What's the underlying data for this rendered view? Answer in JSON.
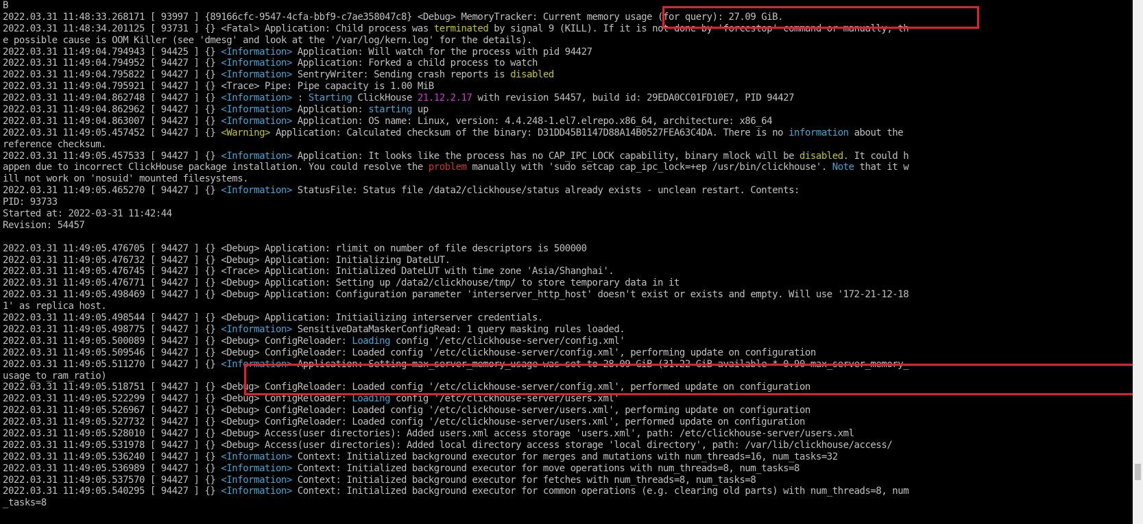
{
  "top_char": "B",
  "lines": [
    [
      {
        "t": "2022.03.31 11:48:33.268171 [ 93997 ] {89166cfc-9547-4cfa-bbf9-c7ae358047c8} <Debug> MemoryTracker: Current memory usage (for query): 27.09 GiB."
      }
    ],
    [
      {
        "t": "2022.03.31 11:48:34.201125 [ 93731 ] {} <Fatal> Application: Child process was "
      },
      {
        "t": "terminated",
        "c": "hl-y"
      },
      {
        "t": " by signal 9 (KILL). If it is not done by 'forcestop' command or manually, th"
      }
    ],
    [
      {
        "t": "e possible cause is OOM Killer (see 'dmesg' and look at the '/var/log/kern.log' for the details)."
      }
    ],
    [
      {
        "t": "2022.03.31 11:49:04.794943 [ 94425 ] {} "
      },
      {
        "t": "<Information>",
        "c": "lvl-info"
      },
      {
        "t": " Application: Will watch for the process with pid 94427"
      }
    ],
    [
      {
        "t": "2022.03.31 11:49:04.794952 [ 94427 ] {} "
      },
      {
        "t": "<Information>",
        "c": "lvl-info"
      },
      {
        "t": " Application: Forked a child process to watch"
      }
    ],
    [
      {
        "t": "2022.03.31 11:49:04.795822 [ 94427 ] {} "
      },
      {
        "t": "<Information>",
        "c": "lvl-info"
      },
      {
        "t": " SentryWriter: Sending crash reports is "
      },
      {
        "t": "disabled",
        "c": "hl-y"
      }
    ],
    [
      {
        "t": "2022.03.31 11:49:04.795921 [ 94427 ] {} <Trace> Pipe: Pipe capacity is 1.00 MiB"
      }
    ],
    [
      {
        "t": "2022.03.31 11:49:04.862748 [ 94427 ] {} "
      },
      {
        "t": "<Information>",
        "c": "lvl-info"
      },
      {
        "t": " : "
      },
      {
        "t": "Starting",
        "c": "hl-b"
      },
      {
        "t": " ClickHouse "
      },
      {
        "t": "21.12.2.17",
        "c": "hl-m"
      },
      {
        "t": " with revision 54457, build id: 29EDA0CC01FD10E7, PID 94427"
      }
    ],
    [
      {
        "t": "2022.03.31 11:49:04.862962 [ 94427 ] {} "
      },
      {
        "t": "<Information>",
        "c": "lvl-info"
      },
      {
        "t": " Application: "
      },
      {
        "t": "starting",
        "c": "hl-b"
      },
      {
        "t": " up"
      }
    ],
    [
      {
        "t": "2022.03.31 11:49:04.863007 [ 94427 ] {} "
      },
      {
        "t": "<Information>",
        "c": "lvl-info"
      },
      {
        "t": " Application: OS name: Linux, version: 4.4.248-1.el7.elrepo.x86_64, architecture: x86_64"
      }
    ],
    [
      {
        "t": "2022.03.31 11:49:05.457452 [ 94427 ] {} "
      },
      {
        "t": "<Warning>",
        "c": "lvl-warn"
      },
      {
        "t": " Application: Calculated checksum of the binary: D31DD45B1147D88A14B0527FEA63C4DA. There is no "
      },
      {
        "t": "information",
        "c": "hl-b"
      },
      {
        "t": " about the"
      }
    ],
    [
      {
        "t": "reference checksum."
      }
    ],
    [
      {
        "t": "2022.03.31 11:49:05.457533 [ 94427 ] {} "
      },
      {
        "t": "<Information>",
        "c": "lvl-info"
      },
      {
        "t": " Application: It looks like the process has no CAP_IPC_LOCK capability, binary mlock will be "
      },
      {
        "t": "disabled",
        "c": "hl-y"
      },
      {
        "t": ". It could h"
      }
    ],
    [
      {
        "t": "appen due to incorrect ClickHouse package installation. You could resolve the "
      },
      {
        "t": "problem",
        "c": "hl-r"
      },
      {
        "t": " manually with 'sudo setcap cap_ipc_lock=+ep /usr/bin/clickhouse'. "
      },
      {
        "t": "Note",
        "c": "hl-b"
      },
      {
        "t": " that it w"
      }
    ],
    [
      {
        "t": "ill not work on 'nosuid' mounted filesystems."
      }
    ],
    [
      {
        "t": "2022.03.31 11:49:05.465270 [ 94427 ] {} "
      },
      {
        "t": "<Information>",
        "c": "lvl-info"
      },
      {
        "t": " StatusFile: Status file /data2/clickhouse/status already exists - unclean restart. Contents:"
      }
    ],
    [
      {
        "t": "PID: 93733"
      }
    ],
    [
      {
        "t": "Started at: 2022-03-31 11:42:44"
      }
    ],
    [
      {
        "t": "Revision: 54457"
      }
    ],
    [
      {
        "t": ""
      }
    ],
    [
      {
        "t": "2022.03.31 11:49:05.476705 [ 94427 ] {} <Debug> Application: rlimit on number of file descriptors is 500000"
      }
    ],
    [
      {
        "t": "2022.03.31 11:49:05.476732 [ 94427 ] {} <Debug> Application: Initializing DateLUT."
      }
    ],
    [
      {
        "t": "2022.03.31 11:49:05.476745 [ 94427 ] {} <Trace> Application: Initialized DateLUT with time zone 'Asia/Shanghai'."
      }
    ],
    [
      {
        "t": "2022.03.31 11:49:05.476771 [ 94427 ] {} <Debug> Application: Setting up /data2/clickhouse/tmp/ to store temporary data in it"
      }
    ],
    [
      {
        "t": "2022.03.31 11:49:05.498469 [ 94427 ] {} <Debug> Application: Configuration parameter 'interserver_http_host' doesn't exist or exists and empty. Will use '172-21-12-18"
      }
    ],
    [
      {
        "t": "1' as replica host."
      }
    ],
    [
      {
        "t": "2022.03.31 11:49:05.498544 [ 94427 ] {} <Debug> Application: Initiailizing interserver credentials."
      }
    ],
    [
      {
        "t": "2022.03.31 11:49:05.498775 [ 94427 ] {} "
      },
      {
        "t": "<Information>",
        "c": "lvl-info"
      },
      {
        "t": " SensitiveDataMaskerConfigRead: 1 query masking rules loaded."
      }
    ],
    [
      {
        "t": "2022.03.31 11:49:05.500089 [ 94427 ] {} <Debug> ConfigReloader: "
      },
      {
        "t": "Loading",
        "c": "hl-b"
      },
      {
        "t": " config '/etc/clickhouse-server/config.xml'"
      }
    ],
    [
      {
        "t": "2022.03.31 11:49:05.509546 [ 94427 ] {} <Debug> ConfigReloader: Loaded config '/etc/clickhouse-server/config.xml', performing update on configuration"
      }
    ],
    [
      {
        "t": "2022.03.31 11:49:05.511270 [ 94427 ] {} "
      },
      {
        "t": "<Information>",
        "c": "lvl-info"
      },
      {
        "t": " Application: Setting max_server_memory_usage was set to 28.09 GiB (31.22 GiB available * 0.90 max_server_memory_"
      }
    ],
    [
      {
        "t": "usage_to_ram_ratio)"
      }
    ],
    [
      {
        "t": "2022.03.31 11:49:05.518751 [ 94427 ] {} <Debug> ConfigReloader: Loaded config '/etc/clickhouse-server/config.xml', performed update on configuration"
      }
    ],
    [
      {
        "t": "2022.03.31 11:49:05.522299 [ 94427 ] {} <Debug> ConfigReloader: "
      },
      {
        "t": "Loading",
        "c": "hl-b"
      },
      {
        "t": " config '/etc/clickhouse-server/users.xml'"
      }
    ],
    [
      {
        "t": "2022.03.31 11:49:05.526967 [ 94427 ] {} <Debug> ConfigReloader: Loaded config '/etc/clickhouse-server/users.xml', performing update on configuration"
      }
    ],
    [
      {
        "t": "2022.03.31 11:49:05.527732 [ 94427 ] {} <Debug> ConfigReloader: Loaded config '/etc/clickhouse-server/users.xml', performed update on configuration"
      }
    ],
    [
      {
        "t": "2022.03.31 11:49:05.528010 [ 94427 ] {} <Debug> Access(user directories): Added users.xml access storage 'users.xml', path: /etc/clickhouse-server/users.xml"
      }
    ],
    [
      {
        "t": "2022.03.31 11:49:05.531978 [ 94427 ] {} <Debug> Access(user directories): Added local directory access storage 'local directory', path: /var/lib/clickhouse/access/"
      }
    ],
    [
      {
        "t": "2022.03.31 11:49:05.536240 [ 94427 ] {} "
      },
      {
        "t": "<Information>",
        "c": "lvl-info"
      },
      {
        "t": " Context: Initialized background executor for merges and mutations with num_threads=16, num_tasks=32"
      }
    ],
    [
      {
        "t": "2022.03.31 11:49:05.536989 [ 94427 ] {} "
      },
      {
        "t": "<Information>",
        "c": "lvl-info"
      },
      {
        "t": " Context: Initialized background executor for move operations with num_threads=8, num_tasks=8"
      }
    ],
    [
      {
        "t": "2022.03.31 11:49:05.537570 [ 94427 ] {} "
      },
      {
        "t": "<Information>",
        "c": "lvl-info"
      },
      {
        "t": " Context: Initialized background executor for fetches with num_threads=8, num_tasks=8"
      }
    ],
    [
      {
        "t": "2022.03.31 11:49:05.540295 [ 94427 ] {} "
      },
      {
        "t": "<Information>",
        "c": "lvl-info"
      },
      {
        "t": " Context: Initialized background executor for common operations (e.g. clearing old parts) with num_threads=8, num"
      }
    ],
    [
      {
        "t": "_tasks=8"
      }
    ]
  ]
}
